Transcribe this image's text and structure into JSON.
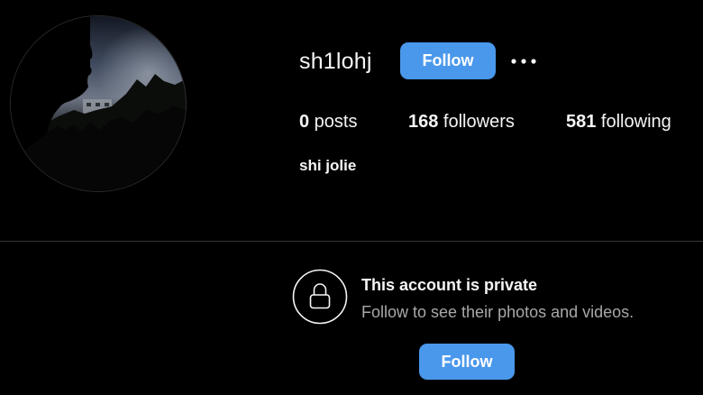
{
  "profile": {
    "username": "sh1lohj",
    "full_name": "shi jolie",
    "follow_label": "Follow"
  },
  "stats": {
    "posts_count": "0",
    "posts_label": " posts",
    "followers_count": "168",
    "followers_label": " followers",
    "following_count": "581",
    "following_label": " following"
  },
  "private_notice": {
    "title": "This account is private",
    "subtitle": "Follow to see their photos and videos.",
    "follow_label": "Follow"
  },
  "icons": {
    "more": "more-options-icon",
    "lock": "lock-icon"
  },
  "colors": {
    "background": "#000000",
    "accent": "#4a98eb",
    "text_primary": "#f5f5f5",
    "text_secondary": "#a8a8a8",
    "divider": "#363636"
  }
}
